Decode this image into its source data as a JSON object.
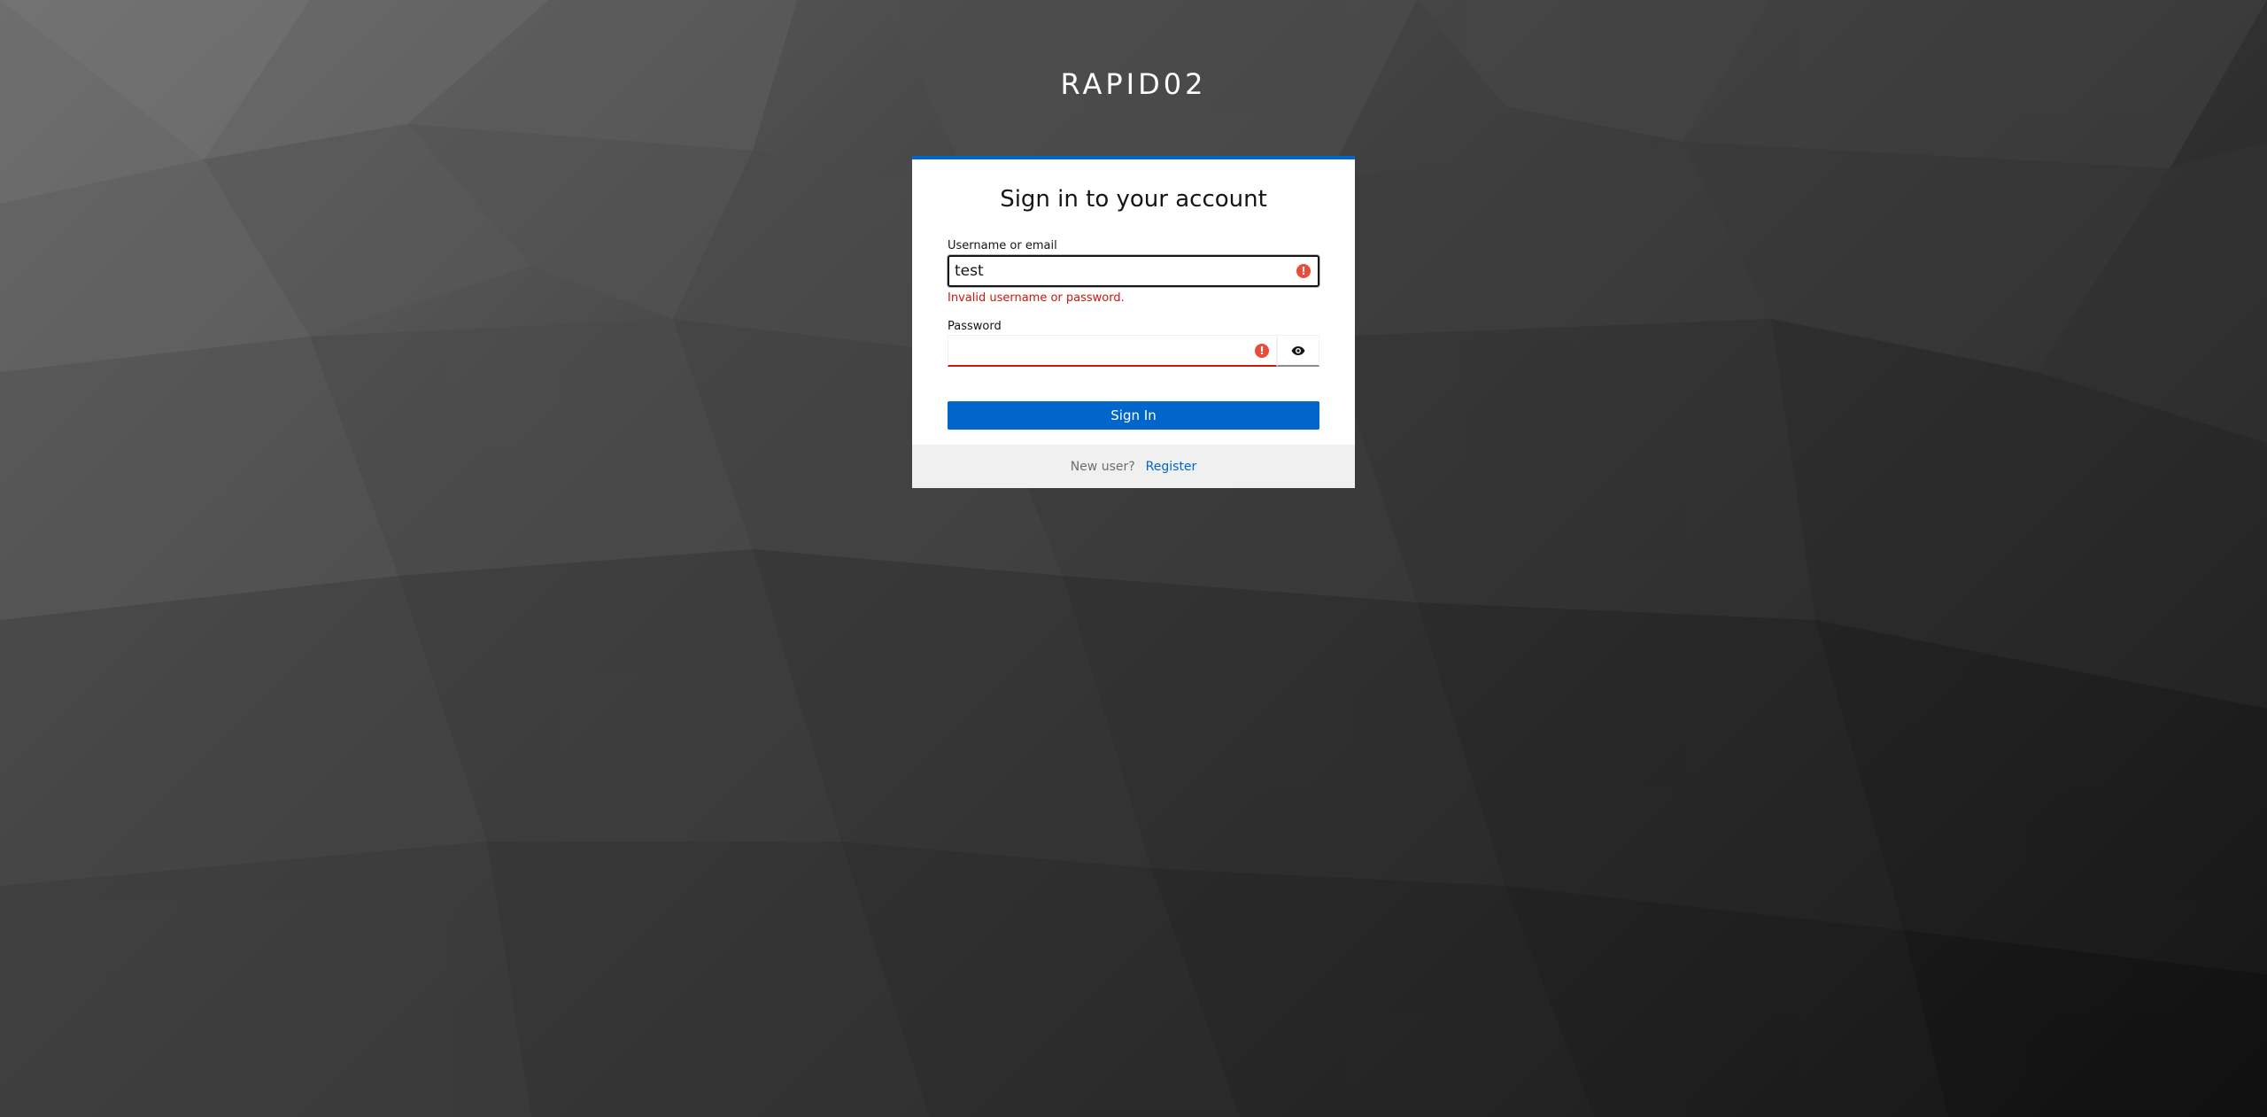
{
  "realm": {
    "title": "RAPID02"
  },
  "login": {
    "heading": "Sign in to your account",
    "username": {
      "label": "Username or email",
      "value": "test",
      "error_icon": "!"
    },
    "error_message": "Invalid username or password.",
    "password": {
      "label": "Password",
      "value": "",
      "error_icon": "!",
      "toggle_icon": "eye-icon"
    },
    "submit_label": "Sign In"
  },
  "footer": {
    "new_user_text": "New user?",
    "register_label": "Register"
  },
  "colors": {
    "primary": "#0066cc",
    "error": "#c9190b",
    "error_icon": "#e74c3c",
    "footer_bg": "#f0f0f0"
  }
}
